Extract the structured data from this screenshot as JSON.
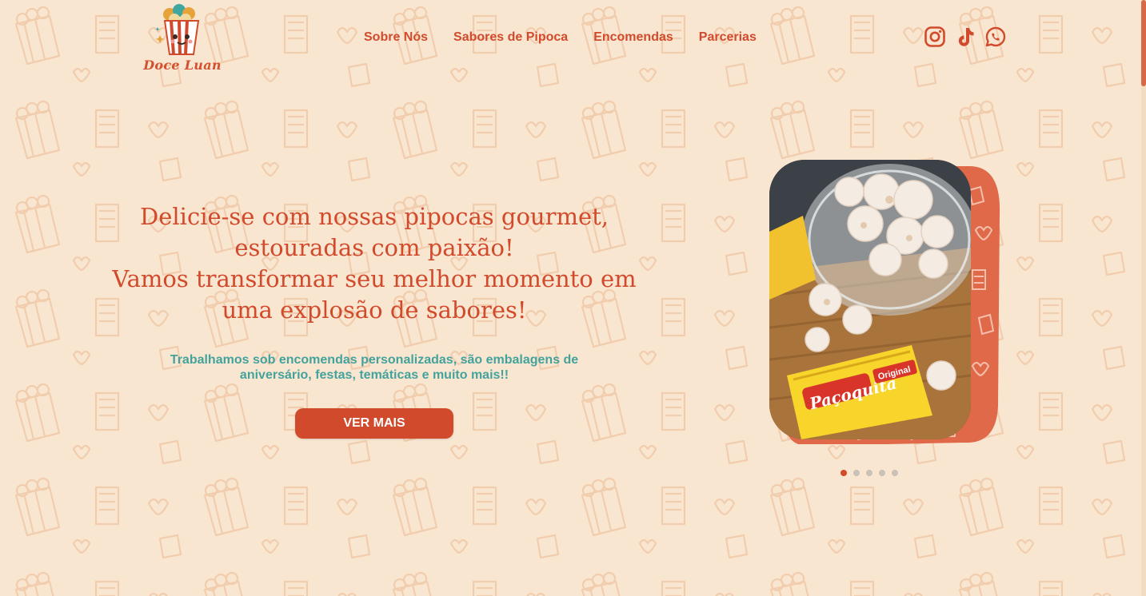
{
  "brand": {
    "name": "Doce Luan",
    "logo_icon": "popcorn-mascot-icon"
  },
  "nav": {
    "items": [
      {
        "label": "Sobre Nós"
      },
      {
        "label": "Sabores de Pipoca"
      },
      {
        "label": "Encomendas"
      },
      {
        "label": "Parcerias"
      }
    ]
  },
  "socials": [
    {
      "icon": "instagram-icon"
    },
    {
      "icon": "tiktok-icon"
    },
    {
      "icon": "whatsapp-icon"
    }
  ],
  "hero": {
    "title": "Delicie-se com nossas pipocas gourmet,\nestouradas com paixão!\nVamos transformar seu melhor momento em\numa explosão de sabores!",
    "subtitle": "Trabalhamos sob encomendas personalizadas, são embalagens de aniversário, festas, temáticas e muito mais!!",
    "cta_label": "VER MAIS"
  },
  "carousel": {
    "slide_count": 5,
    "active_index": 0,
    "product_label": "Paçoquita",
    "product_tag": "Original"
  },
  "colors": {
    "background": "#f9e6d0",
    "accent": "#d24a2c",
    "teal": "#44a29d",
    "pattern": "#f0c9a8"
  }
}
